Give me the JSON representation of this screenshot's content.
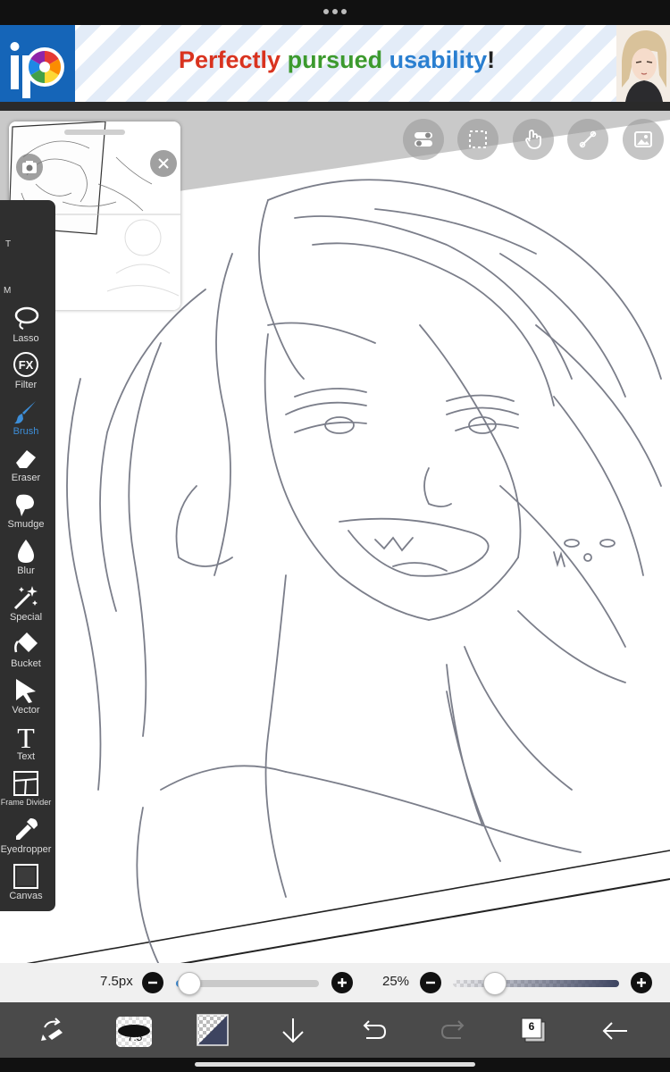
{
  "ad": {
    "word1": "Perfectly",
    "word2": "pursued",
    "word3": "usability",
    "word4": "!",
    "colors": {
      "word1": "#d9331f",
      "word2": "#3c9a2e",
      "word3": "#2a7fd0",
      "word4": "#222222",
      "logo_bg": "#1565b8"
    }
  },
  "top_tools": [
    {
      "icon": "toggle-icon",
      "active": true
    },
    {
      "icon": "selection-icon",
      "active": false
    },
    {
      "icon": "hand-icon",
      "active": false
    },
    {
      "icon": "ruler-icon",
      "active": false
    },
    {
      "icon": "image-icon",
      "active": false
    }
  ],
  "toolbar": {
    "partial": [
      "T",
      "M"
    ],
    "tools": [
      {
        "label": "Lasso",
        "icon": "lasso-icon"
      },
      {
        "label": "Filter",
        "icon": "fx-icon",
        "glyph": "FX"
      },
      {
        "label": "Brush",
        "icon": "brush-icon",
        "active": true
      },
      {
        "label": "Eraser",
        "icon": "eraser-icon"
      },
      {
        "label": "Smudge",
        "icon": "smudge-icon"
      },
      {
        "label": "Blur",
        "icon": "blur-icon"
      },
      {
        "label": "Special",
        "icon": "special-icon"
      },
      {
        "label": "Bucket",
        "icon": "bucket-icon"
      },
      {
        "label": "Vector",
        "icon": "vector-icon"
      },
      {
        "label": "Text",
        "icon": "text-icon",
        "glyph": "T"
      },
      {
        "label": "Frame Divider",
        "icon": "frame-divider-icon"
      },
      {
        "label": "Eyedropper",
        "icon": "eyedropper-icon"
      },
      {
        "label": "Canvas",
        "icon": "canvas-icon"
      }
    ]
  },
  "brush_controls": {
    "size_label": "7.5px",
    "size_slider_value": 0.05,
    "opacity_label": "25%",
    "opacity_slider_value": 0.25
  },
  "bottom_bar": {
    "brush_size": "7.5",
    "layer_count": "6",
    "icons": [
      "transform-icon",
      "brush-preview-icon",
      "color-swatch-icon",
      "download-icon",
      "undo-icon",
      "redo-icon",
      "layers-icon",
      "back-arrow-icon"
    ]
  },
  "colors": {
    "accent": "#3d8ed8",
    "toolbar_bg": "#2f2f2f",
    "bottom_bar_bg": "#4a4a4a"
  }
}
